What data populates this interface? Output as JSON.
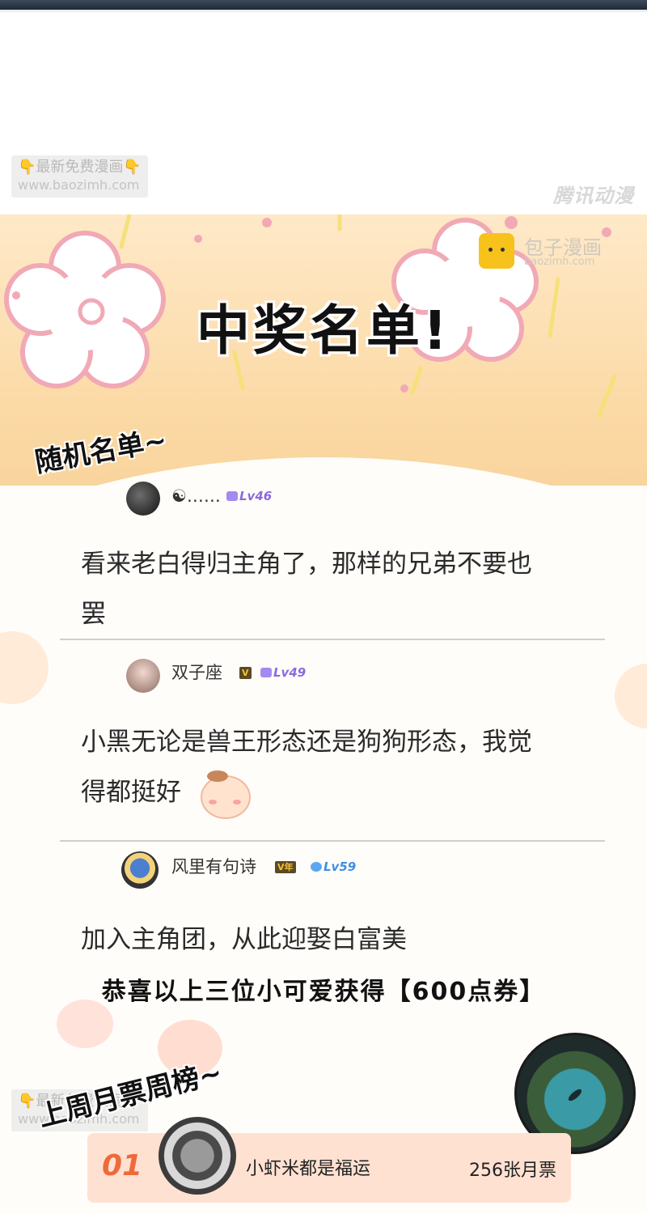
{
  "watermark": {
    "label": "最新免费漫画",
    "hand_icon": "👇",
    "url": "www.baozimh.com",
    "publisher": "腾讯动漫"
  },
  "banner": {
    "title": "中奖名单!",
    "site_name": "包子漫画",
    "site_url": "baozimh.com"
  },
  "random_list": {
    "heading": "随机名单~",
    "comments": [
      {
        "username": "☯……",
        "vip": "",
        "level": "Lv46",
        "text_lines": [
          "看来老白得归主角了，那样的兄弟不要也",
          "罢"
        ]
      },
      {
        "username": "双子座",
        "vip": "V",
        "level": "Lv49",
        "text_lines": [
          "小黑无论是兽王形态还是狗狗形态，我觉",
          "得都挺好"
        ]
      },
      {
        "username": "风里有句诗",
        "vip": "V年",
        "level": "Lv59",
        "text_lines": [
          "加入主角团，从此迎娶白富美"
        ]
      }
    ]
  },
  "congrats": "恭喜以上三位小可爱获得【600点券】",
  "weekly_list": {
    "heading": "上周月票周榜~",
    "entries": [
      {
        "rank": "01",
        "name": "小虾米都是福运",
        "votes": "256张月票"
      }
    ]
  },
  "colors": {
    "banner_bg": "#fbd9a4",
    "rank_row_bg": "#ffe1d2",
    "rank_number": "#ef6a3a",
    "level_purple": "#8a6ae0",
    "level_blue": "#3d8fe6"
  }
}
